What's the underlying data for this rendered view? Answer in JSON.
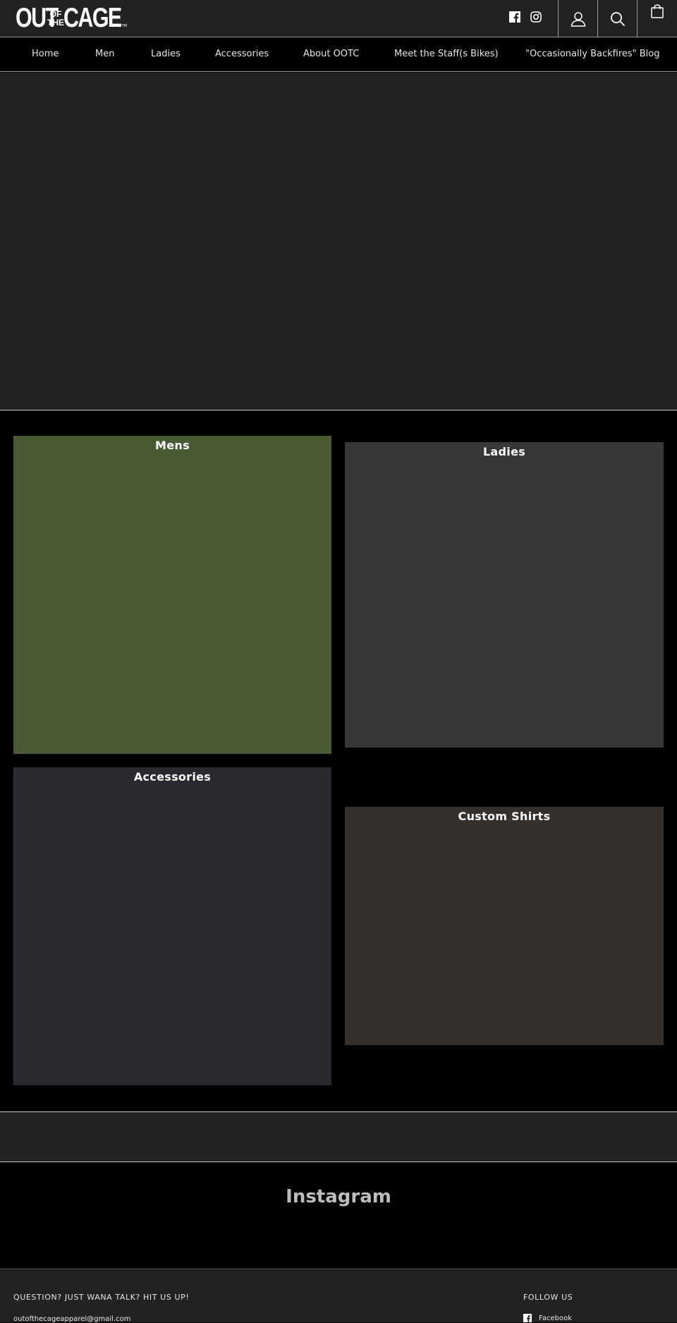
{
  "brand": {
    "logo_out": "OUT",
    "logo_of": "OF",
    "logo_the": "THE",
    "logo_cage": "CAGE",
    "logo_tm": "TM"
  },
  "header": {
    "social_icons": [
      "facebook-icon",
      "instagram-icon"
    ],
    "buttons": [
      "account-icon",
      "search-icon",
      "cart-icon"
    ]
  },
  "nav": {
    "items": [
      {
        "label": "Home"
      },
      {
        "label": "Men"
      },
      {
        "label": "Ladies"
      },
      {
        "label": "Accessories"
      },
      {
        "label": "About OOTC"
      },
      {
        "label": "Meet the Staff(s Bikes)"
      },
      {
        "label": "\"Occasionally Backfires\" Blog"
      }
    ]
  },
  "collections": [
    {
      "title": "Mens",
      "color": "#4a5a35"
    },
    {
      "title": "Ladies",
      "color": "#373737"
    },
    {
      "title": "Accessories",
      "color": "#2a2930"
    },
    {
      "title": "Custom Shirts",
      "color": "#36302d"
    }
  ],
  "instagram": {
    "title": "Instagram"
  },
  "footer": {
    "contact_heading": "QUESTION? JUST WANA TALK? HIT US UP!",
    "contact_email": "outofthecageapparel@gmail.com",
    "follow_heading": "FOLLOW US",
    "follow_facebook": "Facebook"
  },
  "colors": {
    "header_bg": "#222222",
    "page_bg": "#000000",
    "text": "#ffffff"
  }
}
